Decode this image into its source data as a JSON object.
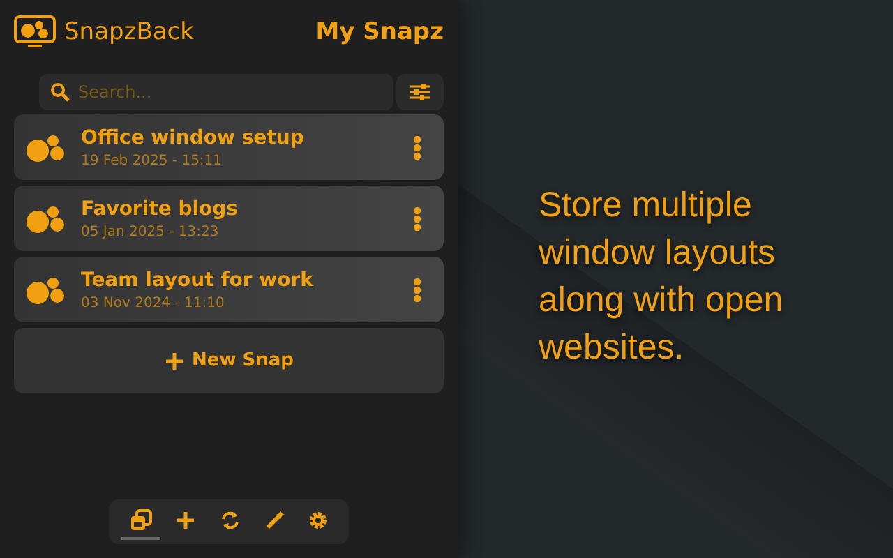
{
  "header": {
    "app_name": "SnapzBack",
    "title": "My Snapz"
  },
  "search": {
    "placeholder": "Search..."
  },
  "snaps": [
    {
      "name": "Office window setup",
      "date": "19 Feb 2025 - 15:11"
    },
    {
      "name": "Favorite blogs",
      "date": "05 Jan 2025 - 13:23"
    },
    {
      "name": "Team layout for work",
      "date": "03 Nov 2024 - 11:10"
    }
  ],
  "new_snap": {
    "label": "New Snap"
  },
  "toolbar": [
    {
      "kind": "snaps",
      "selected": true
    },
    {
      "kind": "add",
      "selected": false
    },
    {
      "kind": "sync",
      "selected": false
    },
    {
      "kind": "magic",
      "selected": false
    },
    {
      "kind": "settings",
      "selected": false
    }
  ],
  "tagline": "Store multiple window layouts along with open websites."
}
